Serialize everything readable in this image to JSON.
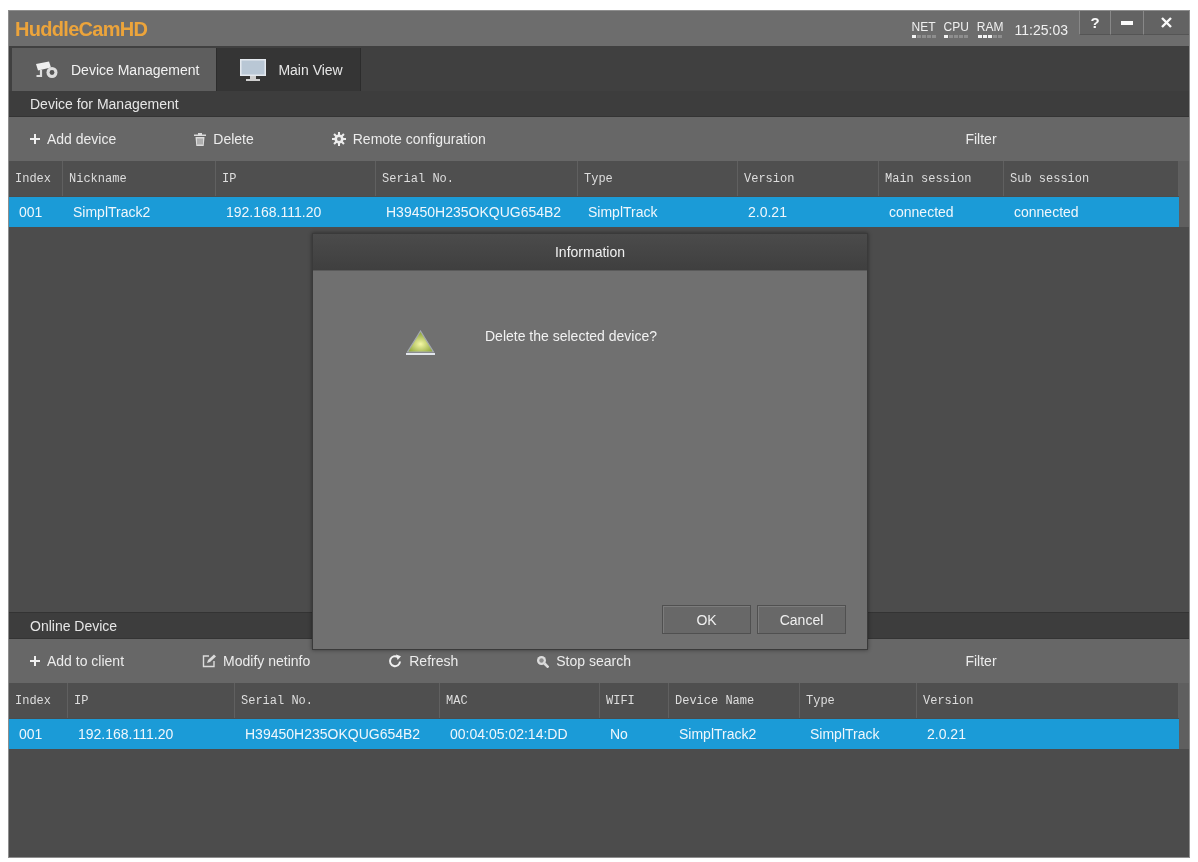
{
  "window": {
    "title": "HuddleCamHD",
    "meters": [
      {
        "label": "NET",
        "level": 0.2
      },
      {
        "label": "CPU",
        "level": 0.2
      },
      {
        "label": "RAM",
        "level": 0.6
      }
    ],
    "time": "11:25:03",
    "buttons": [
      {
        "kind": "help",
        "label": "?"
      },
      {
        "kind": "minimize"
      },
      {
        "kind": "close"
      }
    ]
  },
  "tabs": [
    {
      "label": "Device Management",
      "selected": true
    },
    {
      "label": "Main View",
      "selected": false
    }
  ],
  "device_management": {
    "title": "Device for Management",
    "toolbar": [
      {
        "kind": "add",
        "label": "Add device"
      },
      {
        "kind": "delete",
        "label": "Delete"
      },
      {
        "kind": "configure",
        "label": "Remote configuration"
      }
    ],
    "filter": "Filter",
    "table": {
      "columns": [
        "Index",
        "Nickname",
        "IP",
        "Serial No.",
        "Type",
        "Version",
        "Main session",
        "Sub session"
      ],
      "rows": [
        {
          "selected": true,
          "cells": [
            "001",
            "SimplTrack2",
            "192.168.111.20",
            "H39450H235OKQUG654B2",
            "SimplTrack",
            "2.0.21",
            "connected",
            "connected"
          ]
        }
      ]
    }
  },
  "online_devices": {
    "title": "Online Device",
    "toolbar": [
      {
        "kind": "add",
        "label": "Add to client"
      },
      {
        "kind": "edit",
        "label": "Modify netinfo"
      },
      {
        "kind": "refresh",
        "label": "Refresh"
      },
      {
        "kind": "search",
        "label": "Stop search"
      }
    ],
    "filter": "Filter",
    "table": {
      "columns": [
        "Index",
        "IP",
        "Serial No.",
        "MAC",
        "WIFI",
        "Device Name",
        "Type",
        "Version"
      ],
      "rows": [
        {
          "selected": true,
          "cells": [
            "001",
            "192.168.111.20",
            "H39450H235OKQUG654B2",
            "00:04:05:02:14:DD",
            "No",
            "SimplTrack2",
            "SimplTrack",
            "2.0.21"
          ]
        }
      ]
    }
  },
  "dialog": {
    "title": "Information",
    "message": "Delete the selected device?",
    "buttons": [
      "OK",
      "Cancel"
    ]
  }
}
